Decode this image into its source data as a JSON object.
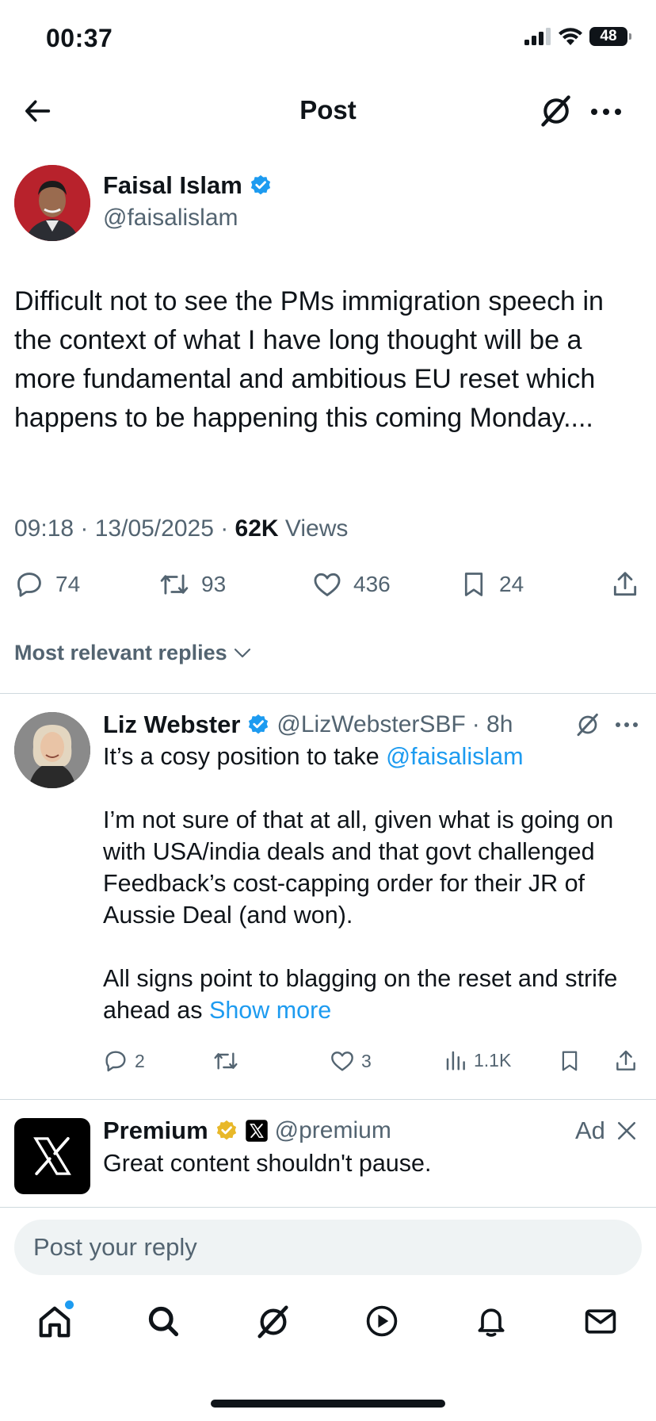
{
  "status_bar": {
    "time": "00:37",
    "battery": "48"
  },
  "header": {
    "title": "Post"
  },
  "post": {
    "author_name": "Faisal Islam",
    "author_handle": "@faisalislam",
    "text": "Difficult not to see the PMs immigration speech in the context of what I have long thought will be a more fundamental and ambitious EU reset which happens to be happening this coming Monday....",
    "timestamp": "09:18 · 13/05/2025 · ",
    "views_count": "62K",
    "views_label": " Views",
    "replies": "74",
    "reposts": "93",
    "likes": "436",
    "bookmarks": "24"
  },
  "replies_filter": "Most relevant replies",
  "reply": {
    "author_name": "Liz Webster",
    "author_handle": "@LizWebsterSBF",
    "time": "· 8h",
    "line1_prefix": "It’s a cosy position to take ",
    "line1_mention": "@faisalislam",
    "para2": "I’m not sure of that at all, given what is going on with USA/india deals and that govt challenged Feedback’s cost-capping order for their JR of Aussie Deal (and won).",
    "para3": "All signs point to blagging on the reset and strife ahead as ",
    "show_more": "Show more",
    "replies": "2",
    "likes": "3",
    "views": "1.1K"
  },
  "ad": {
    "name": "Premium",
    "handle": "@premium",
    "tag": "Ad",
    "text": "Great content shouldn't pause."
  },
  "reply_box": {
    "placeholder": "Post your reply"
  },
  "colors": {
    "accent": "#1d9bf0",
    "muted": "#536471",
    "text": "#0f1419",
    "gold": "#e8b829"
  },
  "icons": [
    "back-arrow-icon",
    "grok-icon",
    "more-icon",
    "verified-icon",
    "reply-icon",
    "repost-icon",
    "like-icon",
    "bookmark-icon",
    "share-icon",
    "views-icon",
    "chevron-down-icon",
    "close-icon",
    "x-logo-icon",
    "home-icon",
    "search-icon",
    "play-icon",
    "bell-icon",
    "mail-icon"
  ]
}
